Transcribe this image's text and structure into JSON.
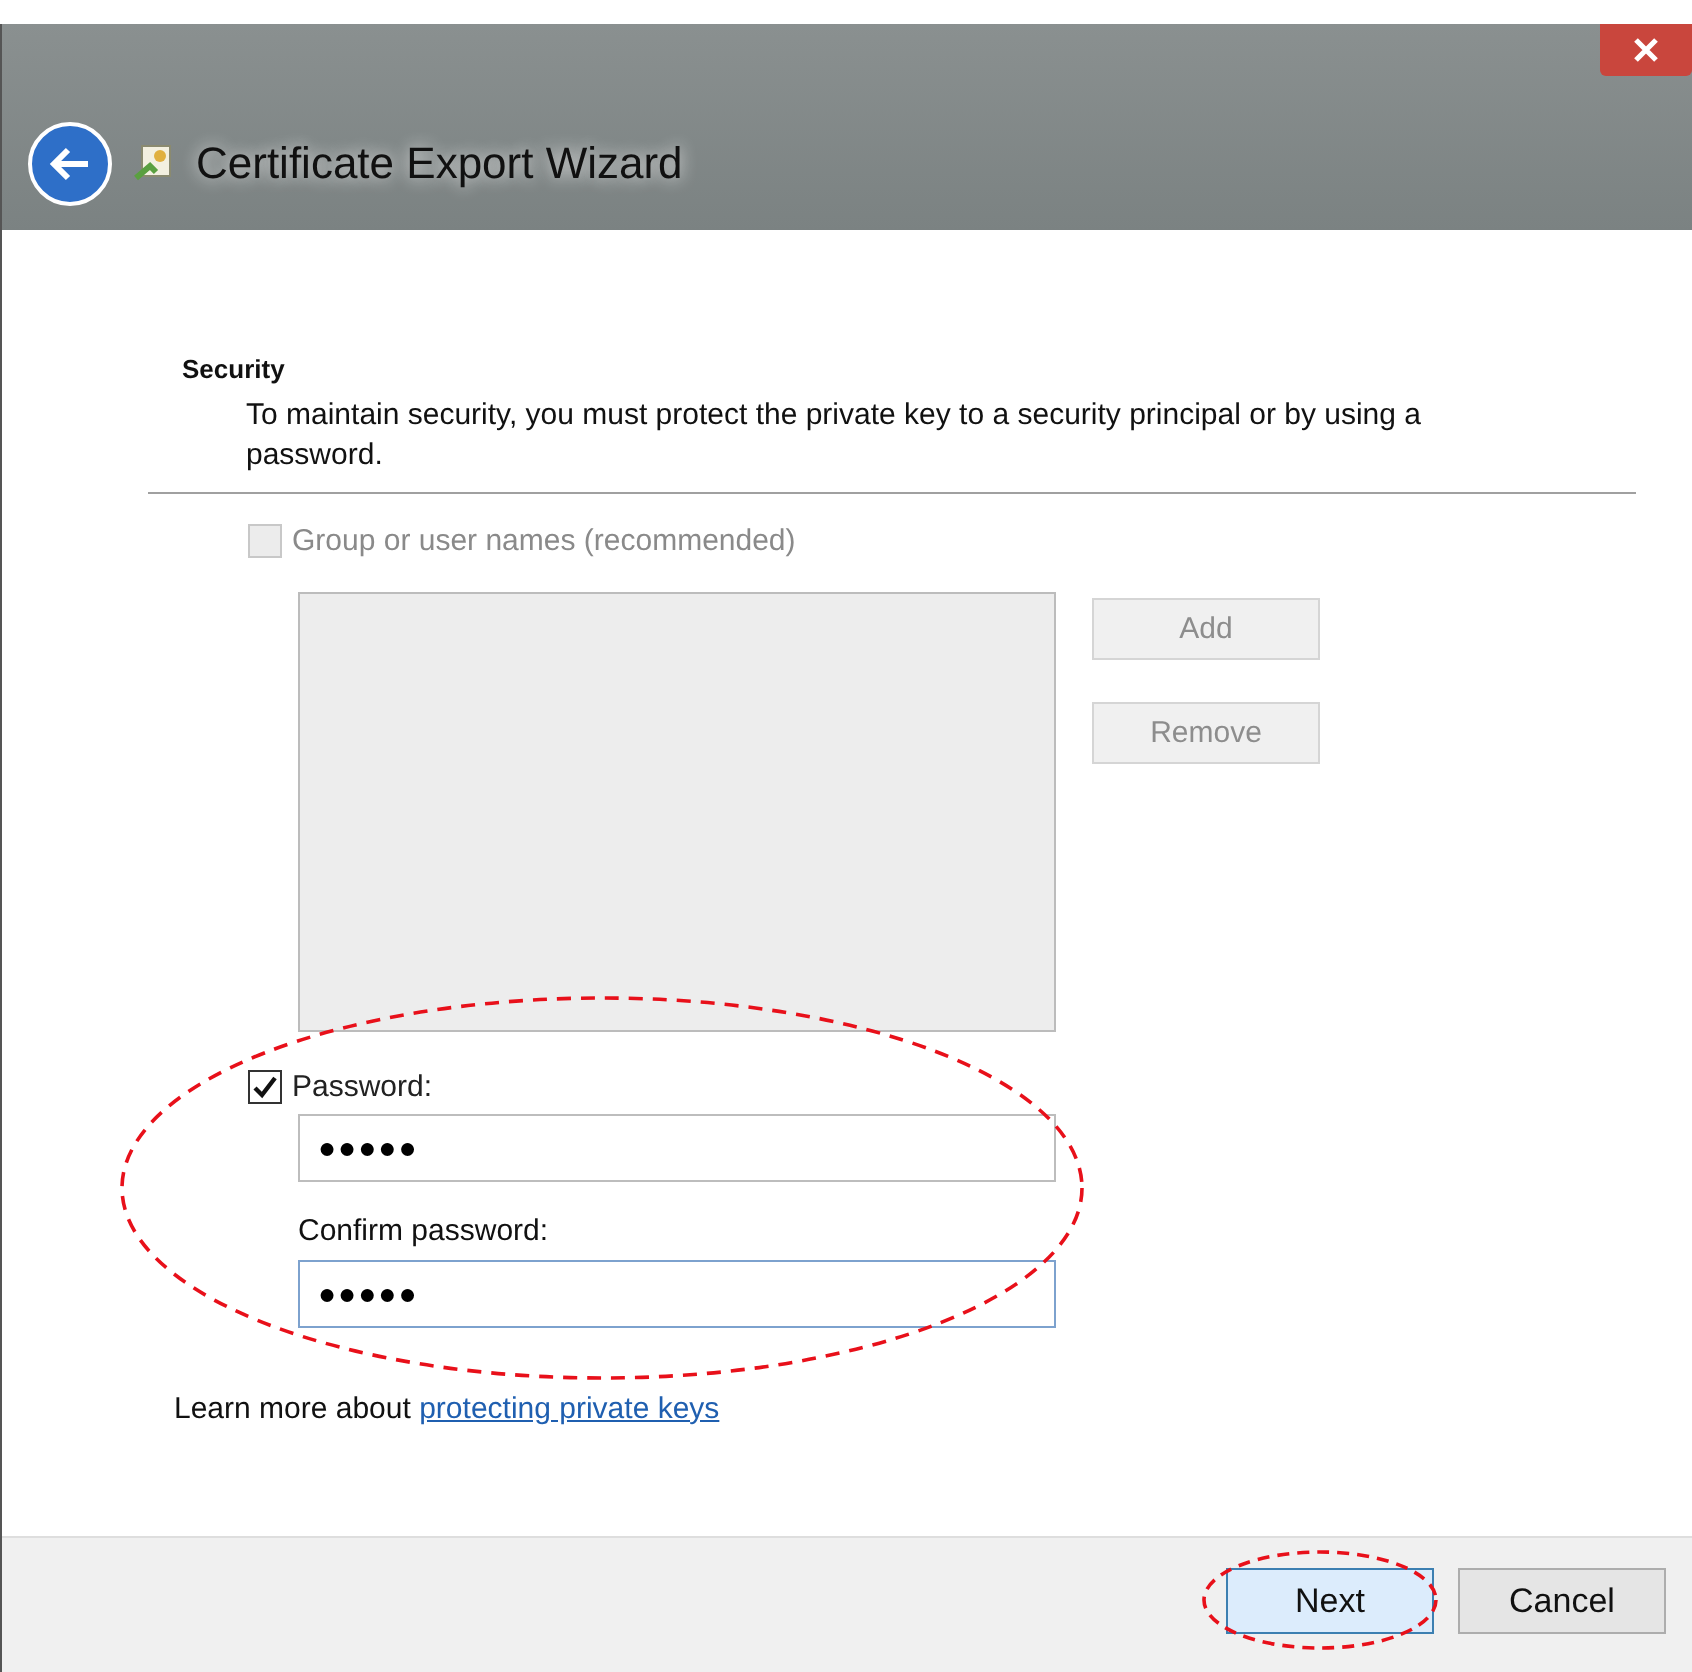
{
  "window": {
    "title": "Certificate Export Wizard"
  },
  "section": {
    "heading": "Security",
    "description": "To maintain security, you must protect the private key to a security principal or by using a password."
  },
  "group_option": {
    "label": "Group or user names (recommended)",
    "checked": false,
    "disabled": true
  },
  "group_buttons": [
    {
      "label": "Add",
      "disabled": true
    },
    {
      "label": "Remove",
      "disabled": true
    }
  ],
  "password_option": {
    "label": "Password:",
    "checked": true,
    "disabled": false
  },
  "password_field": {
    "value": "●●●●●",
    "focused": false
  },
  "confirm_label": "Confirm password:",
  "confirm_field": {
    "value": "●●●●●",
    "focused": true
  },
  "learn_more": {
    "text": "Learn more about",
    "link": "protecting private keys"
  },
  "buttons": [
    {
      "label": "Next",
      "default": true
    },
    {
      "label": "Cancel",
      "default": false
    }
  ]
}
